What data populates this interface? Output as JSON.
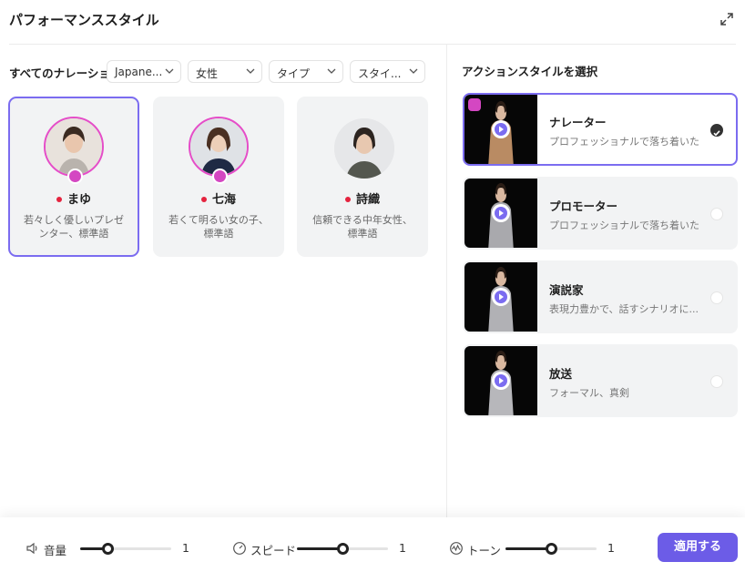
{
  "header": {
    "title": "パフォーマンススタイル"
  },
  "filters": {
    "label": "すべてのナレーション",
    "language": "Japane...",
    "gender": "女性",
    "type": "タイプ",
    "style": "スタイ..."
  },
  "narrators": [
    {
      "name": "まゆ",
      "desc": "若々しく優しいプレゼンター、標準語",
      "selected": true
    },
    {
      "name": "七海",
      "desc": "若くて明るい女の子、標準語",
      "selected": false
    },
    {
      "name": "詩織",
      "desc": "信頼できる中年女性、標準語",
      "selected": false
    }
  ],
  "styles_panel": {
    "heading": "アクションスタイルを選択",
    "items": [
      {
        "name": "ナレーター",
        "desc": "プロフェッショナルで落ち着いた",
        "selected": true
      },
      {
        "name": "プロモーター",
        "desc": "プロフェッショナルで落ち着いた",
        "selected": false
      },
      {
        "name": "演説家",
        "desc": "表現力豊かで、話すシナリオに...",
        "selected": false
      },
      {
        "name": "放送",
        "desc": "フォーマル、真剣",
        "selected": false
      }
    ]
  },
  "footer": {
    "volume": {
      "label": "音量",
      "value": "1",
      "level": 0.3
    },
    "speed": {
      "label": "スピード",
      "value": "1",
      "level": 0.5
    },
    "tone": {
      "label": "トーン",
      "value": "1",
      "level": 0.5
    },
    "apply_label": "適用する"
  },
  "colors": {
    "accent": "#6c5ce7",
    "selected_border": "#7b6cf0",
    "badge": "#d447c2",
    "flag": "#e5233e"
  },
  "icons": [
    "expand-icon",
    "chevron-down-icon",
    "thumbs-up-icon",
    "play-icon",
    "check-icon",
    "speaker-icon",
    "speed-gauge-icon",
    "tone-wave-icon"
  ]
}
